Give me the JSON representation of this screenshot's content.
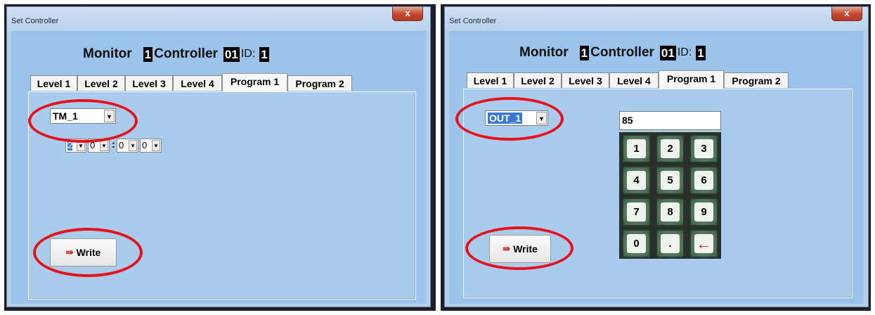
{
  "colors": {
    "ring": "#e8101a",
    "selection": "#3a78d6",
    "keypad_key": "#5d7e64",
    "window_bg": "#9cc3eb"
  },
  "windows": [
    {
      "title": "Set Controller",
      "close_label": "x",
      "header": {
        "monitor_label": "Monitor",
        "monitor_value": "1",
        "controller_label": "Controller",
        "controller_value": "01",
        "id_label": "ID:",
        "id_value": "1"
      },
      "tabs": [
        "Level 1",
        "Level 2",
        "Level 3",
        "Level 4",
        "Program 1",
        "Program 2"
      ],
      "active_tab": "Program 1",
      "selector": {
        "value": "TM_1"
      },
      "time_fields": [
        "2",
        "0",
        "0",
        "0"
      ],
      "time_separator": ":",
      "write_button": {
        "label": "Write",
        "icon": "write-icon"
      }
    },
    {
      "title": "Set Controller",
      "close_label": "x",
      "header": {
        "monitor_label": "Monitor",
        "monitor_value": "1",
        "controller_label": "Controller",
        "controller_value": "01",
        "id_label": "ID:",
        "id_value": "1"
      },
      "tabs": [
        "Level 1",
        "Level 2",
        "Level 3",
        "Level 4",
        "Program 1",
        "Program 2"
      ],
      "active_tab": "Program 1",
      "selector": {
        "value": "OUT_1"
      },
      "value_field": "85",
      "keypad": [
        "1",
        "2",
        "3",
        "4",
        "5",
        "6",
        "7",
        "8",
        "9",
        "0",
        ".",
        "←"
      ],
      "write_button": {
        "label": "Write",
        "icon": "write-icon"
      }
    }
  ]
}
